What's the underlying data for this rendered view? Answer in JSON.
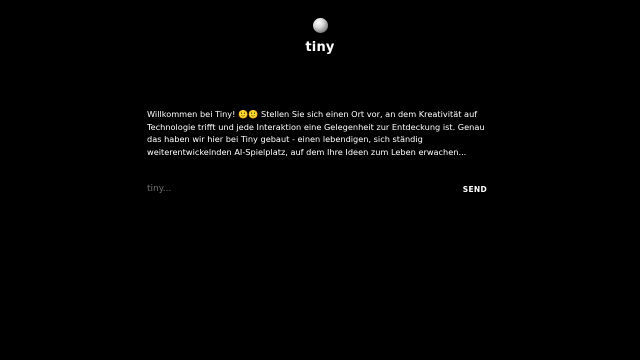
{
  "app": {
    "title": "tiny",
    "logo_icon": "moon-sphere-icon"
  },
  "chat": {
    "welcome_message": "Willkommen bei Tiny! 🙂🙂 Stellen Sie sich einen Ort vor, an dem Kreativität auf Technologie trifft und jede Interaktion eine Gelegenheit zur Entdeckung ist. Genau das haben wir hier bei Tiny gebaut - einen lebendigen, sich ständig weiterentwickelnden AI-Spielplatz, auf dem Ihre Ideen zum Leben erwachen...",
    "input_placeholder": "tiny...",
    "input_value": "",
    "send_label": "SEND"
  },
  "colors": {
    "background": "#000000",
    "text": "#ffffff",
    "placeholder": "#6f6f6f"
  }
}
